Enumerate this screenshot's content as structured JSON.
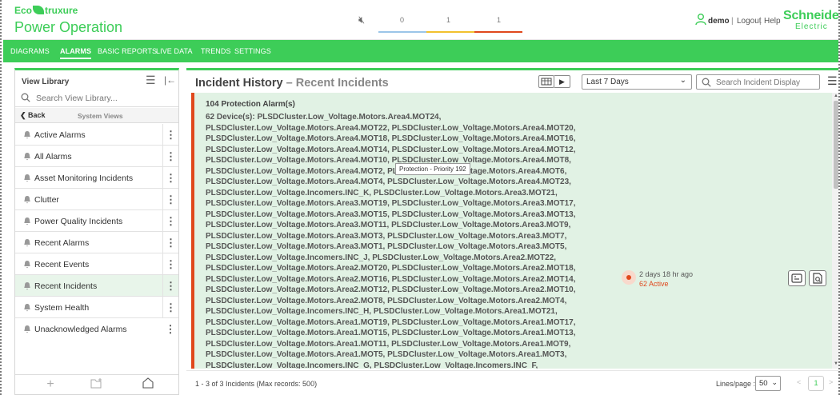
{
  "header": {
    "logo_top_left": "Eco",
    "logo_top_right": "truxure",
    "app_name": "Power Operation",
    "severity": {
      "counts": [
        "0",
        "1",
        "1"
      ],
      "colors": [
        "#9bc5e8",
        "#f2c12e",
        "#e0481c"
      ]
    },
    "user": "demo",
    "logout": "Logout",
    "help": "Help",
    "brand": "Schneider",
    "brand_sub": "Electric"
  },
  "nav": {
    "items": [
      "DIAGRAMS",
      "ALARMS",
      "BASIC REPORTS",
      "LIVE DATA",
      "TRENDS",
      "SETTINGS"
    ],
    "active": "ALARMS"
  },
  "sidebar": {
    "title": "View Library",
    "search_placeholder": "Search View Library...",
    "back": "Back",
    "section": "System Views",
    "items": [
      "Active Alarms",
      "All Alarms",
      "Asset Monitoring Incidents",
      "Clutter",
      "Power Quality Incidents",
      "Recent Alarms",
      "Recent Events",
      "Recent Incidents",
      "System Health",
      "Unacknowledged Alarms"
    ],
    "active_item": "Recent Incidents"
  },
  "main": {
    "title": "Incident History",
    "subtitle": "Recent Incidents",
    "dash": "–",
    "range": "Last 7 Days",
    "search_placeholder": "Search Incident Display",
    "incident": {
      "heading": "104 Protection Alarm(s)",
      "devices": [
        "62 Device(s): PLSDCluster.Low_Voltage.Motors.Area4.MOT24,",
        "PLSDCluster.Low_Voltage.Motors.Area4.MOT22, PLSDCluster.Low_Voltage.Motors.Area4.MOT20,",
        "PLSDCluster.Low_Voltage.Motors.Area4.MOT18, PLSDCluster.Low_Voltage.Motors.Area4.MOT16,",
        "PLSDCluster.Low_Voltage.Motors.Area4.MOT14, PLSDCluster.Low_Voltage.Motors.Area4.MOT12,",
        "PLSDCluster.Low_Voltage.Motors.Area4.MOT10, PLSDCluster.Low_Voltage.Motors.Area4.MOT8,",
        "PLSDCluster.Low_Voltage.Motors.Area4.MOT2, PLSDCluster.Low_Voltage.Motors.Area4.MOT6,",
        "PLSDCluster.Low_Voltage.Motors.Area4.MOT4, PLSDCluster.Low_Voltage.Motors.Area4.MOT23,",
        "PLSDCluster.Low_Voltage.Incomers.INC_K, PLSDCluster.Low_Voltage.Motors.Area3.MOT21,",
        "PLSDCluster.Low_Voltage.Motors.Area3.MOT19, PLSDCluster.Low_Voltage.Motors.Area3.MOT17,",
        "PLSDCluster.Low_Voltage.Motors.Area3.MOT15, PLSDCluster.Low_Voltage.Motors.Area3.MOT13,",
        "PLSDCluster.Low_Voltage.Motors.Area3.MOT11, PLSDCluster.Low_Voltage.Motors.Area3.MOT9,",
        "PLSDCluster.Low_Voltage.Motors.Area3.MOT3, PLSDCluster.Low_Voltage.Motors.Area3.MOT7,",
        "PLSDCluster.Low_Voltage.Motors.Area3.MOT1, PLSDCluster.Low_Voltage.Motors.Area3.MOT5,",
        "PLSDCluster.Low_Voltage.Incomers.INC_J, PLSDCluster.Low_Voltage.Motors.Area2.MOT22,",
        "PLSDCluster.Low_Voltage.Motors.Area2.MOT20, PLSDCluster.Low_Voltage.Motors.Area2.MOT18,",
        "PLSDCluster.Low_Voltage.Motors.Area2.MOT16, PLSDCluster.Low_Voltage.Motors.Area2.MOT14,",
        "PLSDCluster.Low_Voltage.Motors.Area2.MOT12, PLSDCluster.Low_Voltage.Motors.Area2.MOT10,",
        "PLSDCluster.Low_Voltage.Motors.Area2.MOT8, PLSDCluster.Low_Voltage.Motors.Area2.MOT4,",
        "PLSDCluster.Low_Voltage.Incomers.INC_H, PLSDCluster.Low_Voltage.Motors.Area1.MOT21,",
        "PLSDCluster.Low_Voltage.Motors.Area1.MOT19, PLSDCluster.Low_Voltage.Motors.Area1.MOT17,",
        "PLSDCluster.Low_Voltage.Motors.Area1.MOT15, PLSDCluster.Low_Voltage.Motors.Area1.MOT13,",
        "PLSDCluster.Low_Voltage.Motors.Area1.MOT11, PLSDCluster.Low_Voltage.Motors.Area1.MOT9,",
        "PLSDCluster.Low_Voltage.Motors.Area1.MOT5, PLSDCluster.Low_Voltage.Motors.Area1.MOT3,",
        "PLSDCluster.Low_Voltage.Incomers.INC_G, PLSDCluster.Low_Voltage.Incomers.INC_F,"
      ],
      "tooltip": "Protection - Priority 192",
      "time_ago": "2 days 18 hr ago",
      "active": "62 Active"
    },
    "footer": {
      "count": "1 - 3 of 3 Incidents (Max records: 500)",
      "lines_label": "Lines/page :",
      "lines_value": "50",
      "page": "1"
    }
  }
}
